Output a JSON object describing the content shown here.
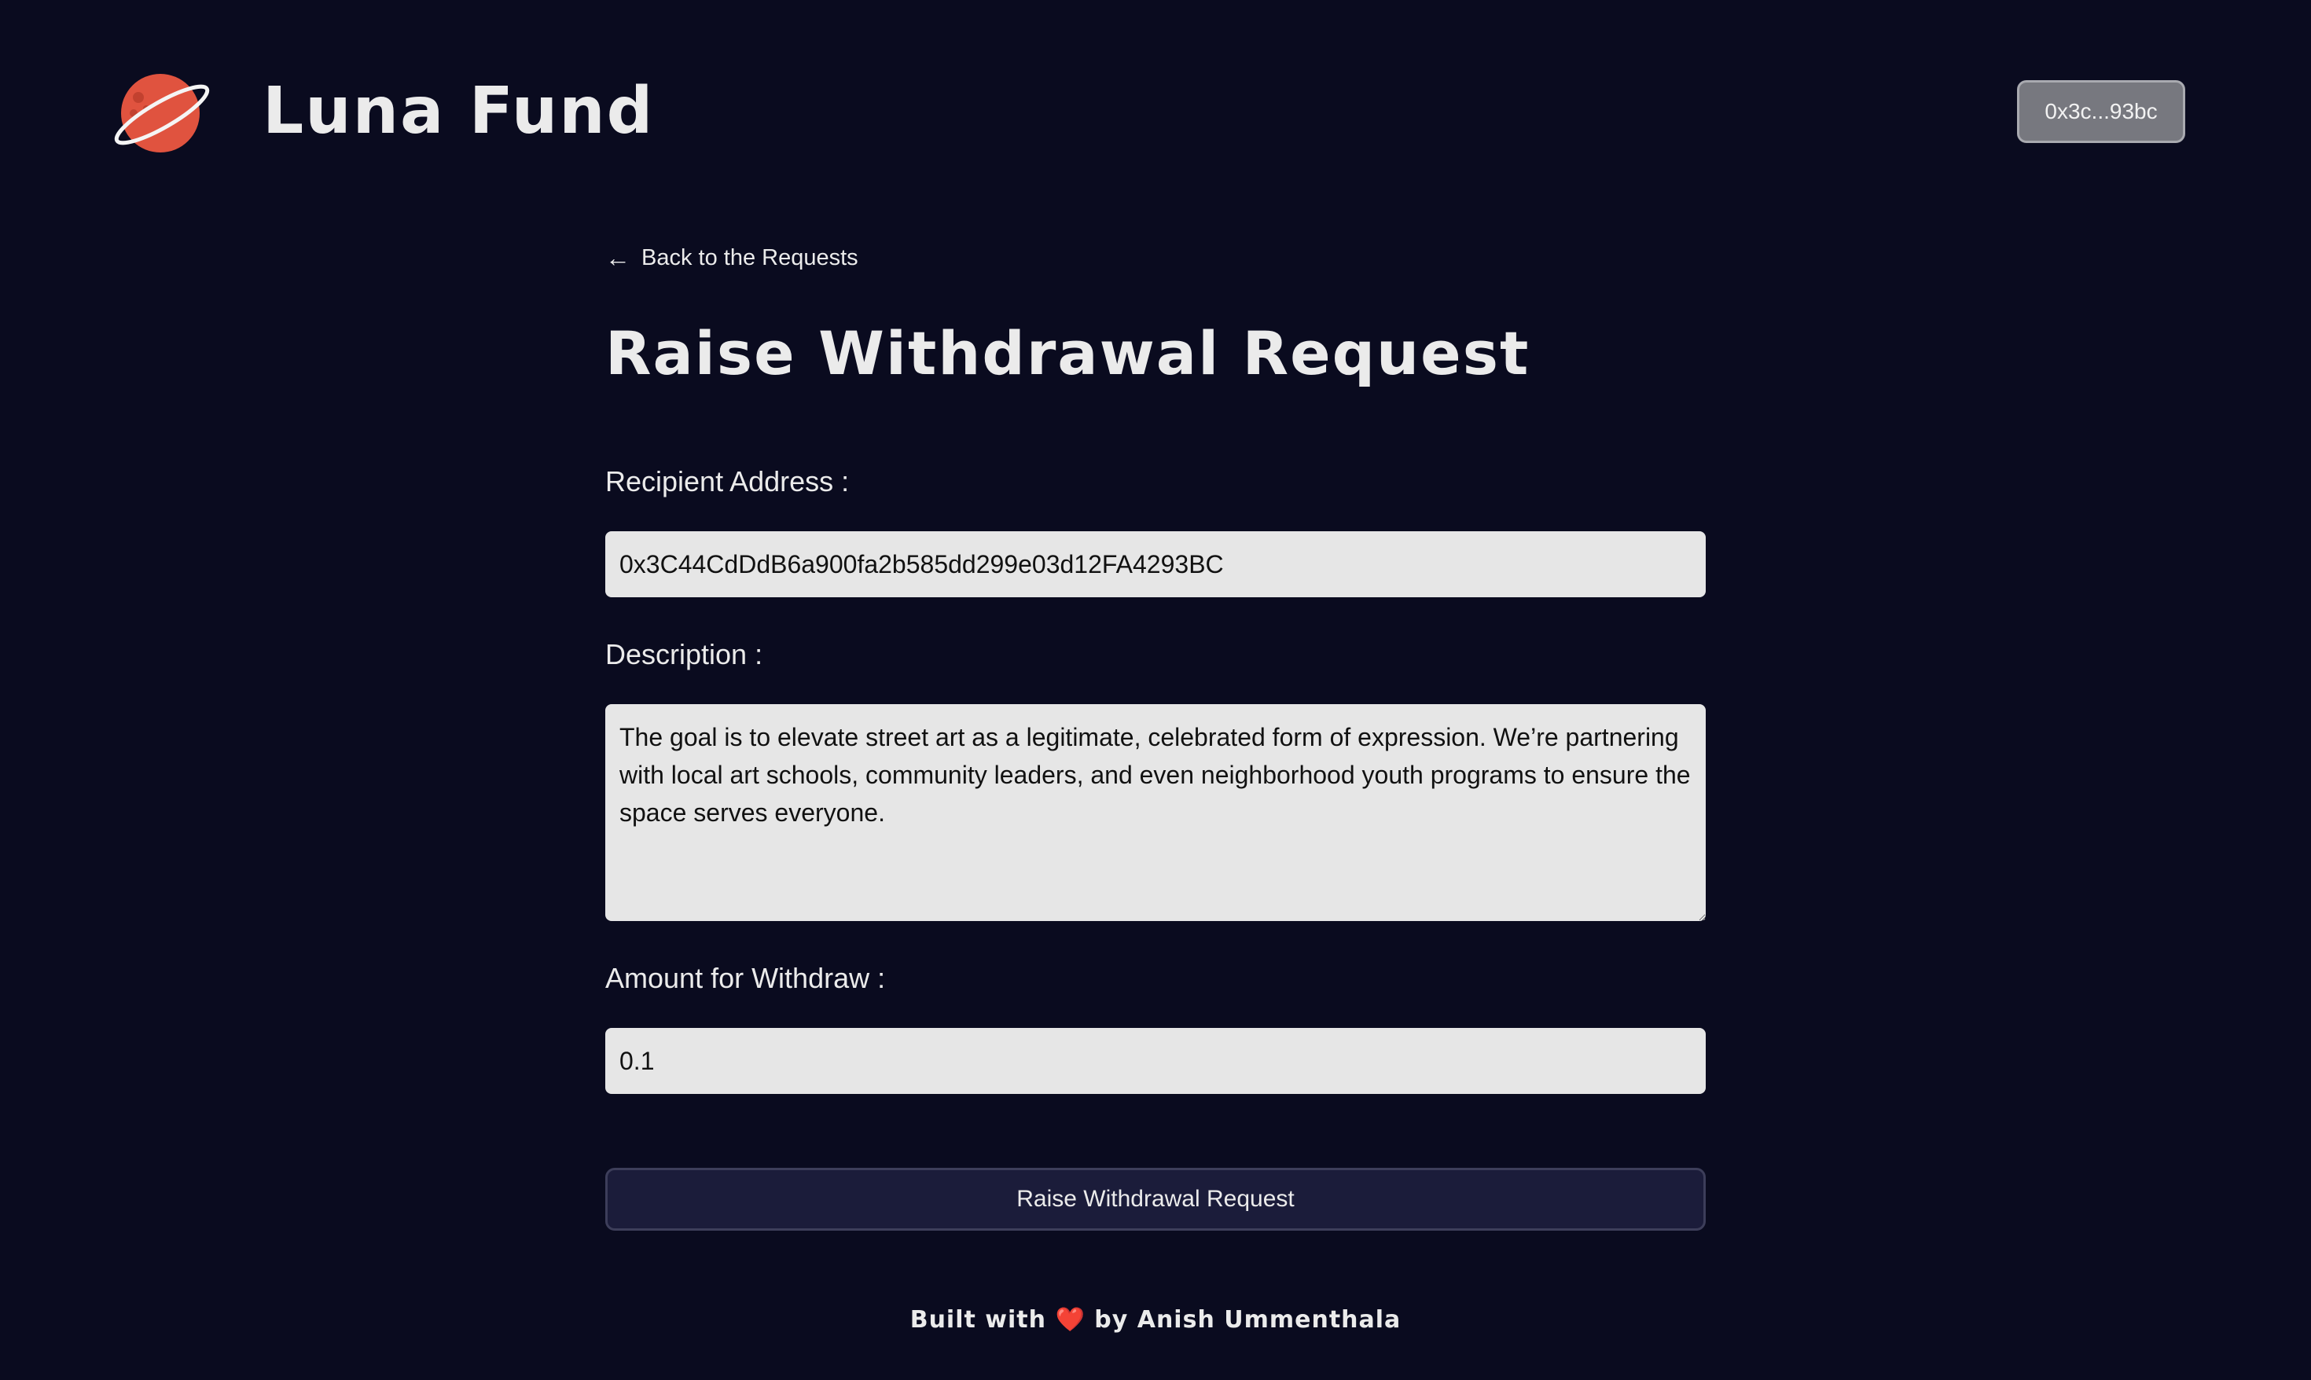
{
  "header": {
    "brand": "Luna Fund",
    "logo_icon": "planet-icon",
    "wallet_label": "0x3c...93bc"
  },
  "nav": {
    "back_label": "Back to the Requests",
    "back_icon": "arrow-left-icon"
  },
  "page": {
    "title": "Raise Withdrawal Request"
  },
  "form": {
    "recipient": {
      "label": "Recipient Address :",
      "value": "0x3C44CdDdB6a900fa2b585dd299e03d12FA4293BC"
    },
    "description": {
      "label": "Description :",
      "value": "The goal is to elevate street art as a legitimate, celebrated form of expression. We’re partnering with local art schools, community leaders, and even neighborhood youth programs to ensure the space serves everyone."
    },
    "amount": {
      "label": "Amount for Withdraw :",
      "value": "0.1"
    },
    "submit_label": "Raise Withdrawal Request"
  },
  "footer": {
    "prefix": "Built with",
    "heart": "❤️",
    "suffix": "by Anish Ummenthala"
  },
  "colors": {
    "background": "#0a0b1f",
    "planet": "#e0533f",
    "button_dark": "#1b1c3a",
    "input_bg": "#e6e6e6"
  }
}
